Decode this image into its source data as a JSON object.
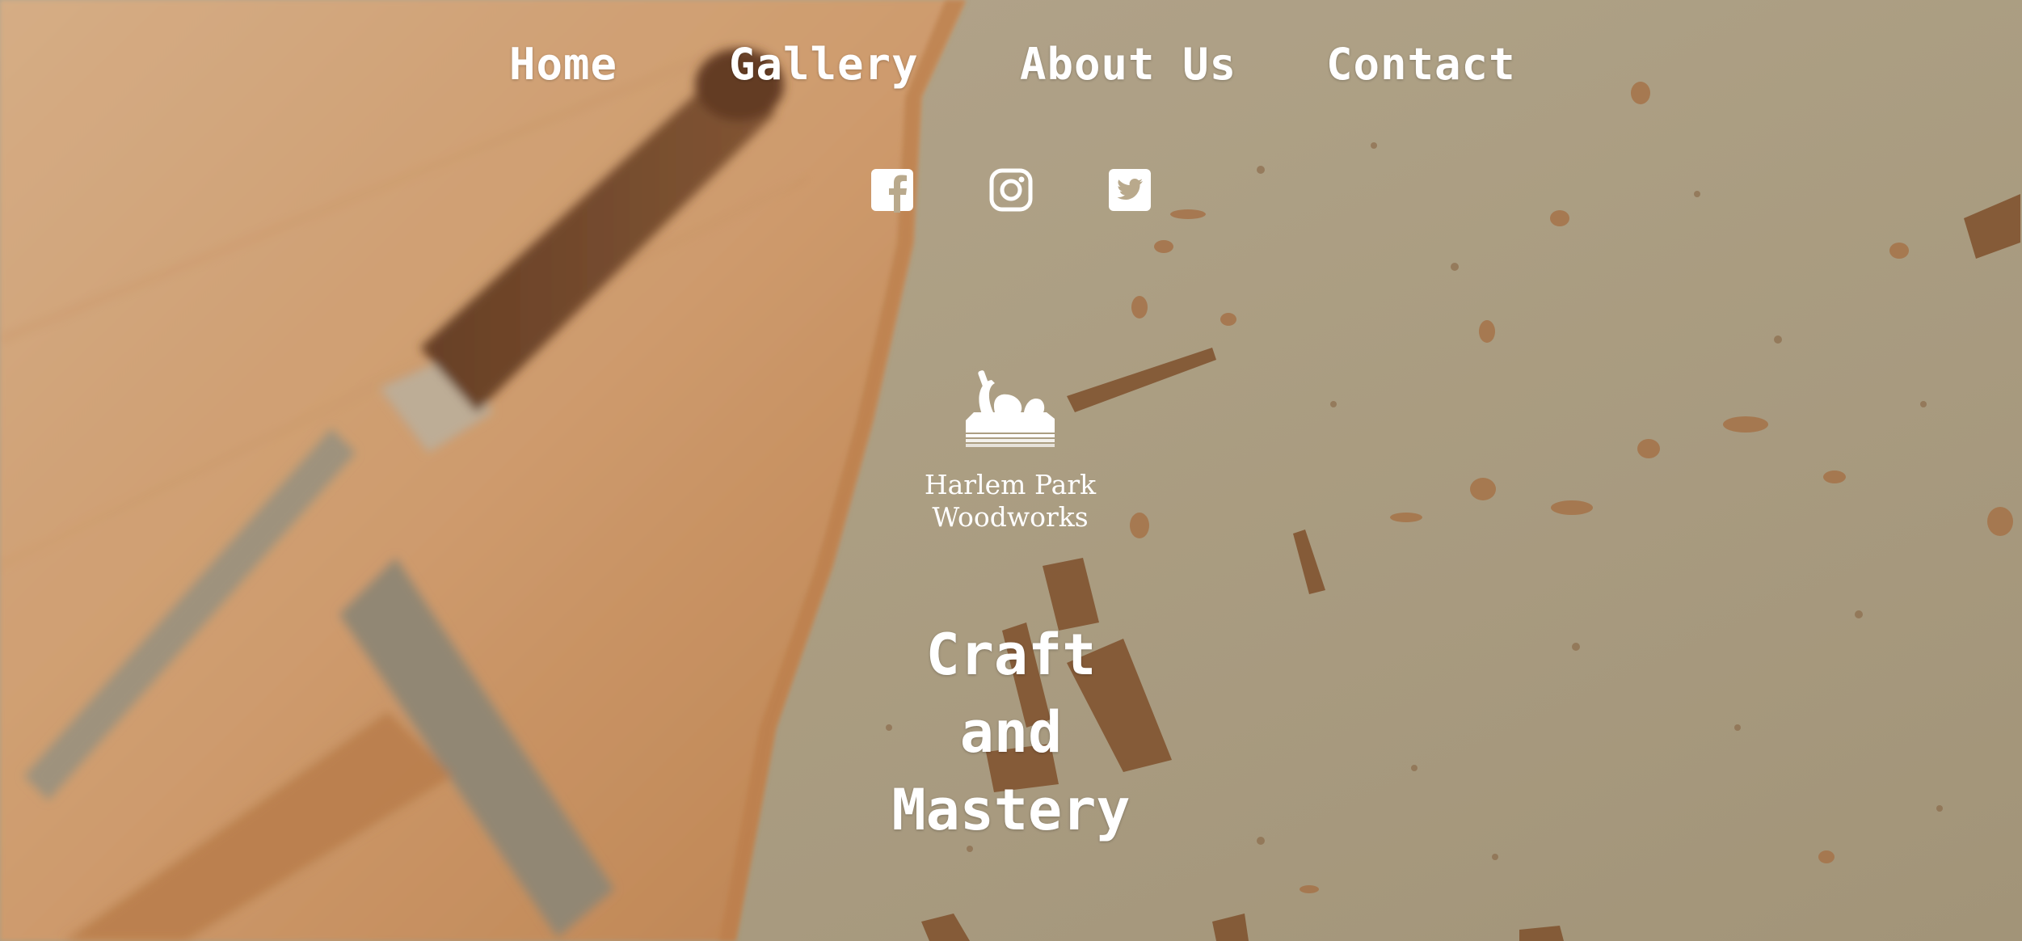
{
  "nav": {
    "items": [
      {
        "label": "Home"
      },
      {
        "label": "Gallery"
      },
      {
        "label": "About Us"
      },
      {
        "label": "Contact"
      }
    ]
  },
  "social": {
    "icons": [
      "facebook-icon",
      "instagram-icon",
      "twitter-icon"
    ]
  },
  "logo": {
    "line1": "Harlem Park",
    "line2": "Woodworks"
  },
  "hero": {
    "tagline_line1": "Craft",
    "tagline_line2": "and",
    "tagline_line3": "Mastery"
  },
  "colors": {
    "text": "#ffffff",
    "wood": "#d9a574",
    "floor": "#b8a888"
  }
}
